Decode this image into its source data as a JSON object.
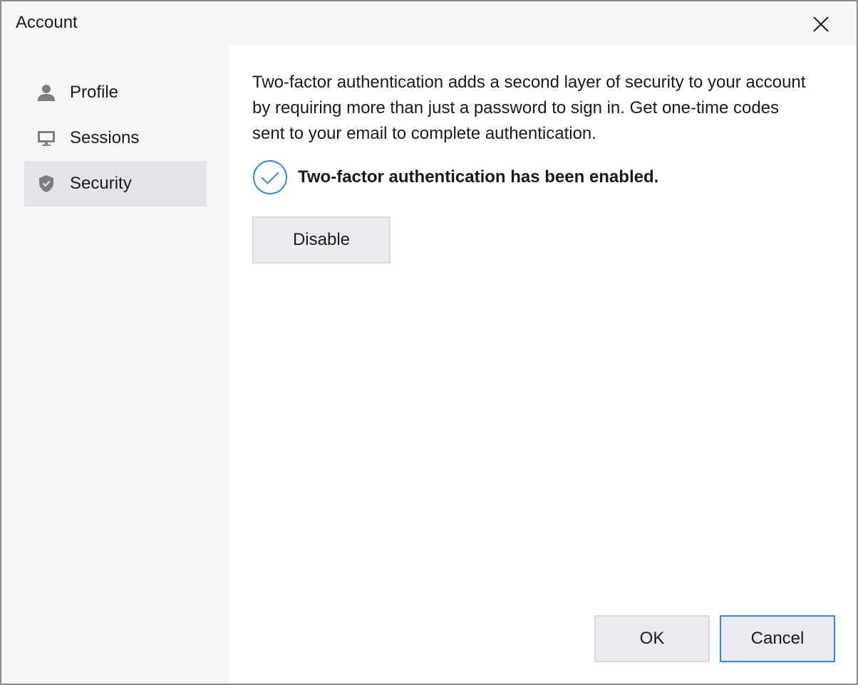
{
  "window": {
    "title": "Account",
    "close_icon": "close-icon"
  },
  "sidebar": {
    "items": [
      {
        "label": "Profile",
        "icon": "person-icon",
        "active": false
      },
      {
        "label": "Sessions",
        "icon": "monitor-icon",
        "active": false
      },
      {
        "label": "Security",
        "icon": "shield-icon",
        "active": true
      }
    ]
  },
  "security": {
    "description": "Two-factor authentication adds a second layer of security to your account by requiring more than just a password to sign in. Get one-time codes sent to your email to complete authentication.",
    "status_icon": "check-circle-icon",
    "status_text": "Two-factor authentication has been enabled.",
    "disable_label": "Disable"
  },
  "footer": {
    "ok_label": "OK",
    "cancel_label": "Cancel"
  },
  "colors": {
    "accent": "#2f8ae5",
    "sidebar_bg": "#f6f7f9",
    "active_item_bg": "#e3e5e8",
    "icon_gray": "#7a7f86"
  }
}
